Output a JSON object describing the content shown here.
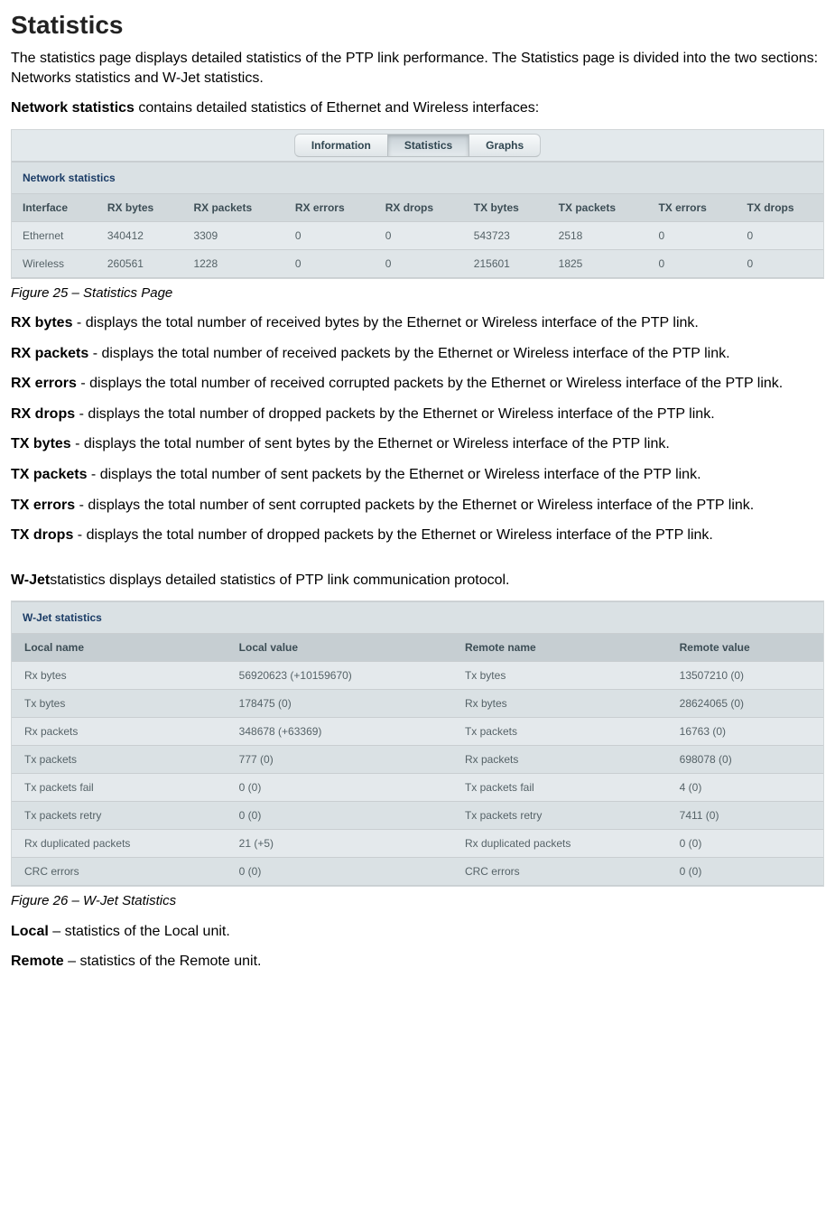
{
  "page": {
    "title": "Statistics",
    "intro": "The statistics page displays detailed statistics of the PTP link performance. The Statistics page is divided into the two sections: Networks statistics and W-Jet statistics.",
    "network_stats_label": "Network statistics",
    "network_stats_desc": " contains detailed statistics of Ethernet and Wireless interfaces:"
  },
  "tabs": {
    "info": "Information",
    "stats": "Statistics",
    "graphs": "Graphs"
  },
  "network_panel": {
    "section_title": "Network statistics",
    "headers": [
      "Interface",
      "RX bytes",
      "RX packets",
      "RX errors",
      "RX drops",
      "TX bytes",
      "TX packets",
      "TX errors",
      "TX drops"
    ],
    "rows": [
      {
        "iface": "Ethernet",
        "rxb": "340412",
        "rxp": "3309",
        "rxe": "0",
        "rxd": "0",
        "txb": "543723",
        "txp": "2518",
        "txe": "0",
        "txd": "0"
      },
      {
        "iface": "Wireless",
        "rxb": "260561",
        "rxp": "1228",
        "rxe": "0",
        "rxd": "0",
        "txb": "215601",
        "txp": "1825",
        "txe": "0",
        "txd": "0"
      }
    ]
  },
  "captions": {
    "fig25": "Figure 25 – Statistics Page",
    "fig26": "Figure 26 – W-Jet Statistics"
  },
  "defs": {
    "rxbytes_t": "RX bytes",
    "rxbytes_d": " - displays the total number of received bytes by the Ethernet or Wireless interface of the PTP link.",
    "rxpackets_t": "RX packets",
    "rxpackets_d": " - displays the total number of received packets by the Ethernet or Wireless interface of the PTP link.",
    "rxerrors_t": "RX errors",
    "rxerrors_d": " - displays the total number of received corrupted packets by the Ethernet or Wireless interface of the PTP link.",
    "rxdrops_t": "RX drops",
    "rxdrops_d": " - displays the total number of dropped packets by the Ethernet or Wireless interface of the PTP link.",
    "txbytes_t": "TX bytes",
    "txbytes_d": " - displays the total number of sent bytes by the Ethernet or Wireless interface of the PTP link.",
    "txpackets_t": "TX packets",
    "txpackets_d": " - displays the total number of sent packets by the Ethernet or Wireless interface of the PTP link.",
    "txerrors_t": "TX errors",
    "txerrors_d": " - displays the total number of sent corrupted packets by the Ethernet or Wireless interface of the PTP link.",
    "txdrops_t": "TX drops",
    "txdrops_d": " - displays the total number of dropped packets by the Ethernet or Wireless interface of the PTP link."
  },
  "wjet_intro": {
    "term": "W-Jet",
    "desc": "statistics displays detailed statistics of PTP link communication protocol."
  },
  "wjet_panel": {
    "section_title": "W-Jet statistics",
    "headers": [
      "Local name",
      "Local value",
      "Remote name",
      "Remote value"
    ],
    "rows": [
      {
        "ln": "Rx bytes",
        "lv": "56920623 (+10159670)",
        "rn": "Tx bytes",
        "rv": "13507210 (0)"
      },
      {
        "ln": "Tx bytes",
        "lv": "178475 (0)",
        "rn": "Rx bytes",
        "rv": "28624065 (0)"
      },
      {
        "ln": "Rx packets",
        "lv": "348678 (+63369)",
        "rn": "Tx packets",
        "rv": "16763 (0)"
      },
      {
        "ln": "Tx packets",
        "lv": "777 (0)",
        "rn": "Rx packets",
        "rv": "698078 (0)"
      },
      {
        "ln": "Tx packets fail",
        "lv": "0 (0)",
        "rn": "Tx packets fail",
        "rv": "4 (0)"
      },
      {
        "ln": "Tx packets retry",
        "lv": "0 (0)",
        "rn": "Tx packets retry",
        "rv": "7411 (0)"
      },
      {
        "ln": "Rx duplicated packets",
        "lv": "21 (+5)",
        "rn": "Rx duplicated packets",
        "rv": "0 (0)"
      },
      {
        "ln": "CRC errors",
        "lv": "0 (0)",
        "rn": "CRC errors",
        "rv": "0 (0)"
      }
    ]
  },
  "footer_defs": {
    "local_t": "Local",
    "local_d": " – statistics of the Local unit.",
    "remote_t": "Remote",
    "remote_d": " – statistics of the Remote unit."
  }
}
